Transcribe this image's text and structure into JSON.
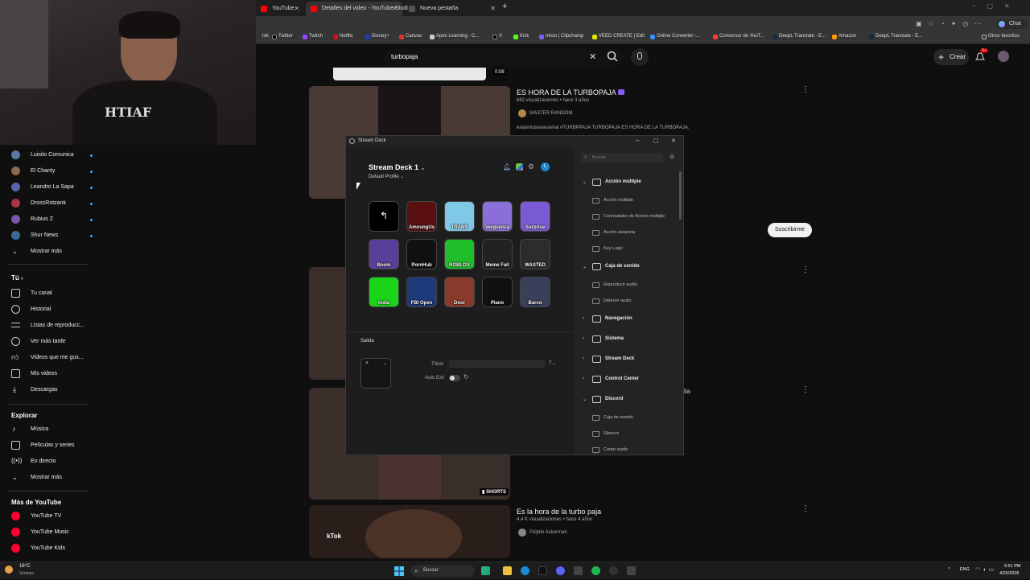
{
  "tabs": [
    {
      "label": "YouTube",
      "color": "#ff0000"
    },
    {
      "label": "Detalles del video - YouTube Studi",
      "color": "#ff0000"
    },
    {
      "label": "Nueva pestaña",
      "color": "#3a3a3a"
    }
  ],
  "bookmarks": [
    "tok",
    "Twitter",
    "Twitch",
    "Netflix",
    "Disney+",
    "Canvas",
    "Apex Learning - C...",
    "X",
    "Kick",
    "Inicio | Clipchamp",
    "VEED CREATE | Edit",
    "Online Converter -...",
    "Conversor de YouT...",
    "DeepL Translate - E...",
    "Amazon",
    "DeepL Translate - E..."
  ],
  "bookmarks_other": "Otros favoritos",
  "chat_label": "Chat",
  "search": {
    "value": "turbopaja"
  },
  "header": {
    "create_label": "Crear",
    "notif_count": "9+"
  },
  "sidebar": {
    "subs": [
      "Luisito Comunica",
      "El Chanty",
      "Leandro La Sapa",
      "DrossRotzank",
      "Rubius Z",
      "Shur News"
    ],
    "show_more": "Mostrar más",
    "you_heading": "Tú",
    "you_items": [
      "Tu canal",
      "Historial",
      "Listas de reproducc...",
      "Ver más tarde",
      "Videos que me gus...",
      "Mis videos",
      "Descargas"
    ],
    "explore_heading": "Explorar",
    "explore_items": [
      "Música",
      "Películas y series",
      "En directo",
      "Mostrar más"
    ],
    "more_heading": "Más de YouTube",
    "more_items": [
      "YouTube TV",
      "YouTube Music",
      "YouTube Kids"
    ]
  },
  "results": [
    {
      "duration": "0:08"
    },
    {
      "title": "ES HORA DE LA TURBOPAJA",
      "meta": "692 visualizaciones • hace 3 años",
      "channel": "MASTER RANDOM",
      "desc": "estamirdasearaviral #TURBPPAJA TURBOPAJA ES HORA DE LA TURBOPAJA."
    },
    {
      "subscribe": "Suscribirme",
      "partial": "ila"
    },
    {
      "badge": "SHORTS"
    },
    {
      "title": "Es la hora de la turbo paja",
      "meta": "4,4 K visualizaciones • hace 4 años",
      "channel": "Púlpito Ackerman",
      "overlay": "kTok"
    }
  ],
  "streamdeck": {
    "window_title": "Stream Deck",
    "device": "Stream Deck 1",
    "profile": "Default Profile",
    "avatar": "L",
    "keys": [
      {
        "label": "",
        "color": "#000000"
      },
      {
        "label": "AmoungUs",
        "color": "#5a0f10"
      },
      {
        "label": "TRANS",
        "color": "#7fc8e8"
      },
      {
        "label": "Verguenza",
        "color": "#8a6fd8"
      },
      {
        "label": "Surprise",
        "color": "#7b5ad6"
      },
      {
        "label": "Boom",
        "color": "#5a3f9a"
      },
      {
        "label": "PornHub",
        "color": "#111111"
      },
      {
        "label": "ROBLOX",
        "color": "#1fbf2a"
      },
      {
        "label": "Meme Fail",
        "color": "#222222"
      },
      {
        "label": "WASTED",
        "color": "#2c2c2c"
      },
      {
        "label": "India",
        "color": "#19d419"
      },
      {
        "label": "FBI Open",
        "color": "#1d3a7a"
      },
      {
        "label": "Door",
        "color": "#8a3a2a"
      },
      {
        "label": "Piano",
        "color": "#101010"
      },
      {
        "label": "Barco",
        "color": "#3a3f5a"
      }
    ],
    "output_label": "Salida",
    "title_label": "Título",
    "auto_exit_label": "Auto Exit",
    "search_placeholder": "Buscar",
    "tree": [
      {
        "type": "cat",
        "label": "Acción múltiple",
        "open": true
      },
      {
        "type": "act",
        "label": "Acción múltiple"
      },
      {
        "type": "act",
        "label": "Conmutador de Acción múltiple"
      },
      {
        "type": "act",
        "label": "Acción aleatoria"
      },
      {
        "type": "act",
        "label": "Key Logic"
      },
      {
        "type": "cat",
        "label": "Caja de sonido",
        "open": true
      },
      {
        "type": "act",
        "label": "Reproducir audio"
      },
      {
        "type": "act",
        "label": "Detener audio"
      },
      {
        "type": "cat",
        "label": "Navegación",
        "open": false
      },
      {
        "type": "cat",
        "label": "Sistema",
        "open": false
      },
      {
        "type": "cat",
        "label": "Stream Deck",
        "open": false
      },
      {
        "type": "cat",
        "label": "Control Center",
        "open": false
      },
      {
        "type": "cat",
        "label": "Discord",
        "open": true
      },
      {
        "type": "act",
        "label": "Caja de sonido"
      },
      {
        "type": "act",
        "label": "Silencio"
      },
      {
        "type": "act",
        "label": "Cortar audio"
      }
    ]
  },
  "taskbar": {
    "weather_temp": "16°C",
    "weather_desc": "Ventoso",
    "search_label": "Buscar",
    "lang": "ENG",
    "time": "9:51 PM",
    "date": "4/25/2026"
  }
}
